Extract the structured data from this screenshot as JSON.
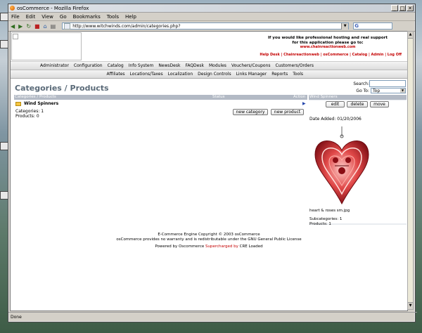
{
  "window": {
    "title": "osCommerce - Mozilla Firefox",
    "ctrl_min": "_",
    "ctrl_max": "□",
    "ctrl_close": "✕"
  },
  "menubar": [
    "File",
    "Edit",
    "View",
    "Go",
    "Bookmarks",
    "Tools",
    "Help"
  ],
  "toolbar": {
    "url": "http://www.witchwinds.com/admin/categories.php?",
    "search_icon": "G"
  },
  "status": {
    "text": "Done"
  },
  "header": {
    "promo_line1": "If you would like professional hosting and real support",
    "promo_line2": "for this application please go to:",
    "promo_url": "www.chainreactionweb.com",
    "links": "Help Desk  |  Chainreactionweb  |  osCommerce  |  Catalog  |  Admin  |  Log Off"
  },
  "nav1": [
    "Administrator",
    "Configuration",
    "Catalog",
    "Info System",
    "NewsDesk",
    "FAQDesk",
    "Modules",
    "Vouchers/Coupons",
    "Customers/Orders"
  ],
  "nav2": [
    "Affiliates",
    "Locations/Taxes",
    "Localization",
    "Design Controls",
    "Links Manager",
    "Reports",
    "Tools"
  ],
  "page": {
    "title": "Categories / Products",
    "search_label": "Search:",
    "goto_label": "Go To:",
    "goto_value": "Top"
  },
  "table": {
    "col_name": "Categories / Products",
    "col_status": "Status",
    "col_action": "Action",
    "row_name": "Wind Spinners",
    "categories_line": "Categories: 1",
    "products_line": "Products: 0",
    "btn_new_category": "new category",
    "btn_new_product": "new product"
  },
  "side": {
    "heading": "Wind Spinners",
    "btn_edit": "edit",
    "btn_delete": "delete",
    "btn_move": "move",
    "date_added": "Date Added: 01/20/2006",
    "image_caption": "heart & roses sm.jpg",
    "subcategories": "Subcategories: 1",
    "products": "Products: 1"
  },
  "footer": {
    "line1": "E-Commerce Engine Copyright © 2003 osCommerce",
    "line2": "osCommerce provides no warranty and is redistributable under the GNU General Public License",
    "powered_prefix": "Powered by Oscommerce",
    "powered_red": "Supercharged by",
    "powered_suffix": "CRE Loaded"
  },
  "colors": {
    "table_header": "#b3bac5",
    "link_red": "#c40000",
    "title_gray": "#5a6a78"
  }
}
